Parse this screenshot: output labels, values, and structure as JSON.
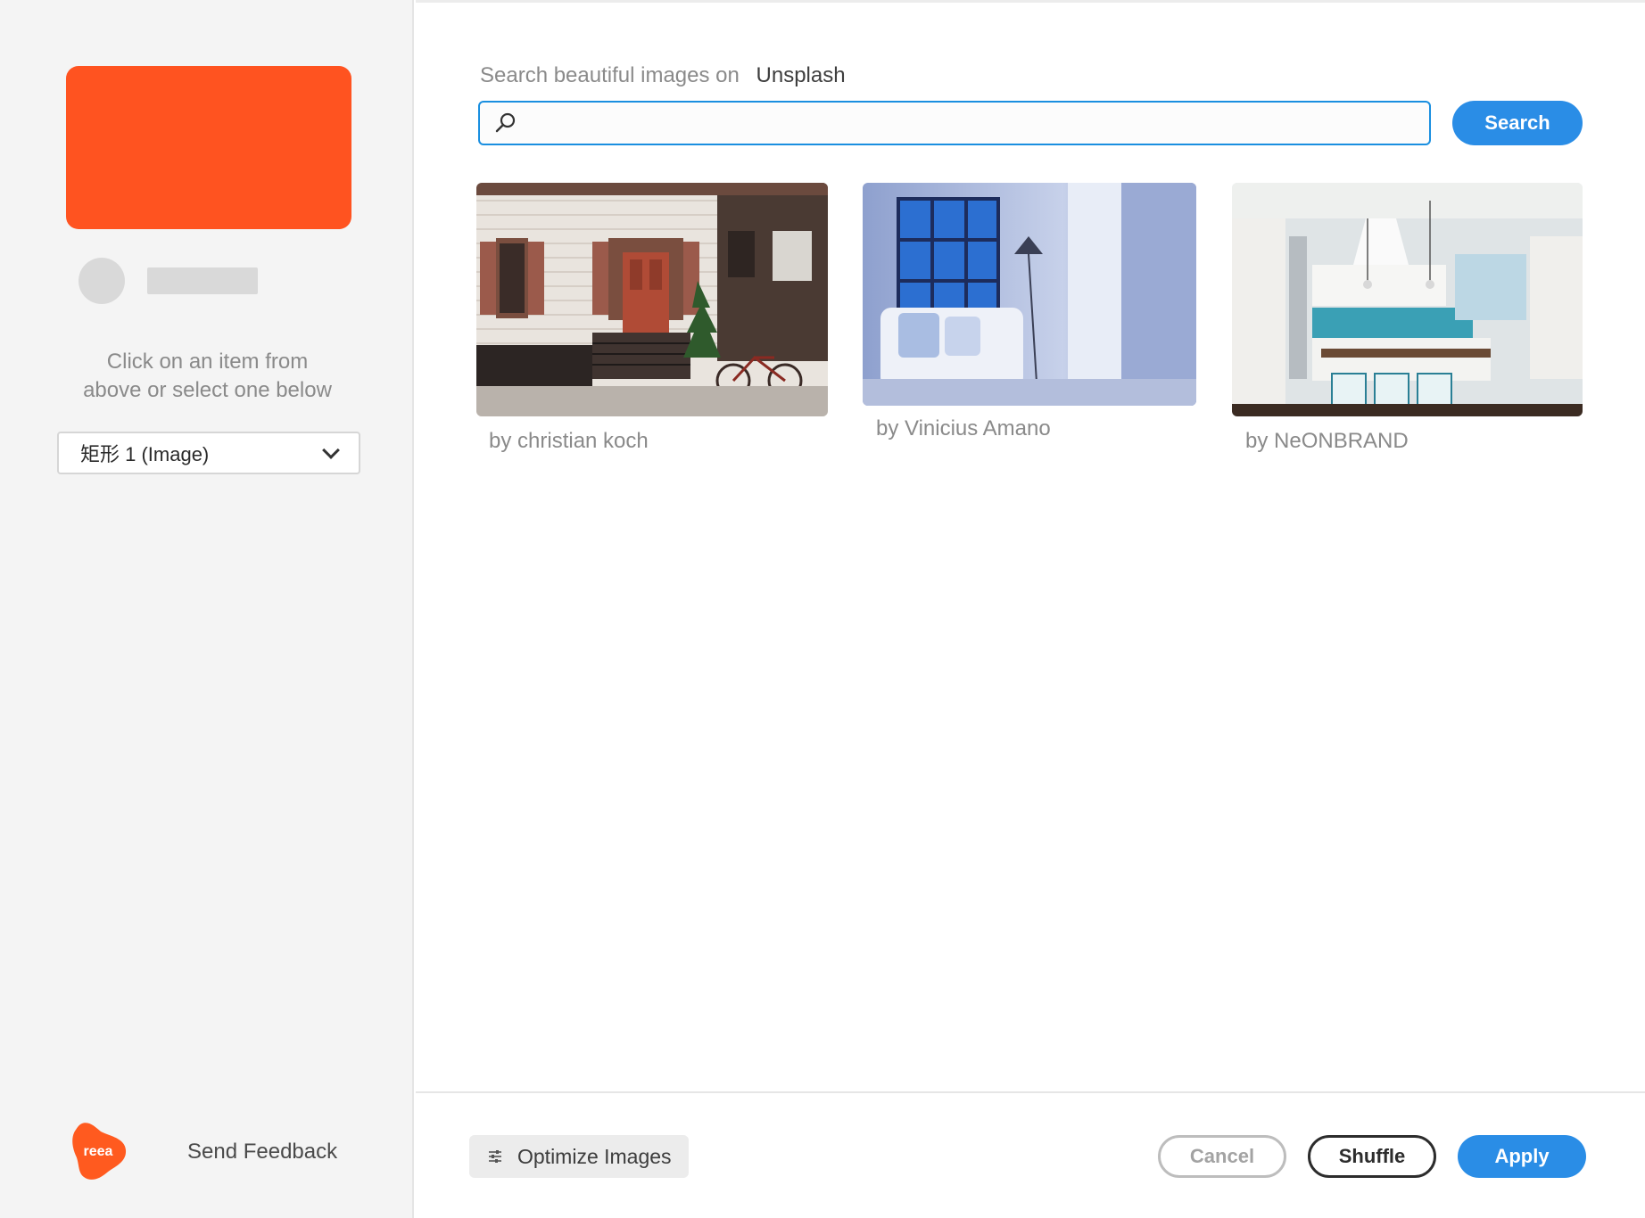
{
  "sidebar": {
    "hint_line1": "Click on an item from",
    "hint_line2": "above or select one below",
    "layer_select": {
      "value": "矩形 1 (Image)"
    },
    "logo_text": "reea",
    "feedback_label": "Send Feedback"
  },
  "search": {
    "label": "Search beautiful images on",
    "brand": "Unsplash",
    "value": "",
    "button_label": "Search"
  },
  "results": [
    {
      "credit": "by christian koch",
      "subject": "townhouse facade with bicycle"
    },
    {
      "credit": "by Vinicius Amano",
      "subject": "blue living room interior"
    },
    {
      "credit": "by NeONBRAND",
      "subject": "white kitchen interior"
    }
  ],
  "footer": {
    "optimize_label": "Optimize Images",
    "cancel_label": "Cancel",
    "shuffle_label": "Shuffle",
    "apply_label": "Apply"
  },
  "colors": {
    "accent": "#2a8de6",
    "preview_card": "#ff5320",
    "logo": "#ff5a1f"
  }
}
